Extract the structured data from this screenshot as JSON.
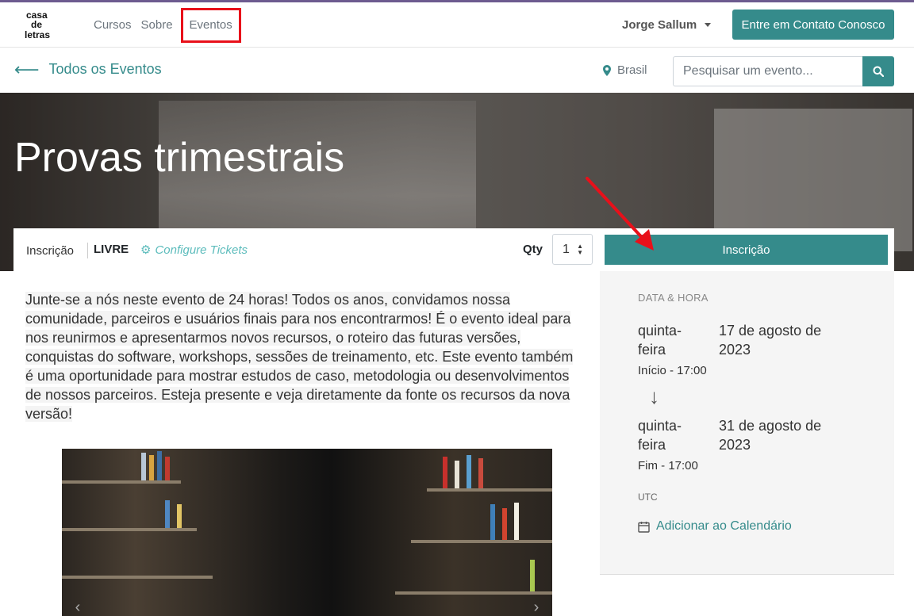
{
  "header": {
    "logo_text": "casa de letras",
    "nav": [
      "Cursos",
      "Sobre",
      "Eventos"
    ],
    "user_name": "Jorge Sallum",
    "cta_label": "Entre em Contato Conosco"
  },
  "subbar": {
    "back_label": "Todos os Eventos",
    "location": "Brasil",
    "search_placeholder": "Pesquisar um evento..."
  },
  "event": {
    "title": "Provas trimestrais",
    "ticket_label": "Inscrição",
    "price": "LIVRE",
    "configure_label": "Configure Tickets",
    "qty_label": "Qty",
    "qty_value": "1",
    "register_label": "Inscrição",
    "description": "Junte-se a nós neste evento de 24 horas! Todos os anos, convidamos nossa comunidade, parceiros e usuários finais para nos encontrarmos! É o evento ideal para nos reunirmos e apresentarmos novos recursos, o roteiro das futuras versões, conquistas do software, workshops, sessões de treinamento, etc. Este evento também é uma oportunidade para mostrar estudos de caso, metodologia ou desenvolvimentos de nossos parceiros. Esteja presente e veja diretamente da fonte os recursos da nova versão!"
  },
  "sidebar": {
    "section_label": "DATA & HORA",
    "start_day": "quinta-feira",
    "start_date": "17 de agosto de 2023",
    "start_time": "Início - 17:00",
    "end_day": "quinta-feira",
    "end_date": "31 de agosto de 2023",
    "end_time": "Fim - 17:00",
    "timezone": "UTC",
    "add_calendar": "Adicionar ao Calendário"
  },
  "colors": {
    "accent": "#358b8b",
    "highlight_box": "#e8101a",
    "annotation_arrow": "#e8101a"
  }
}
